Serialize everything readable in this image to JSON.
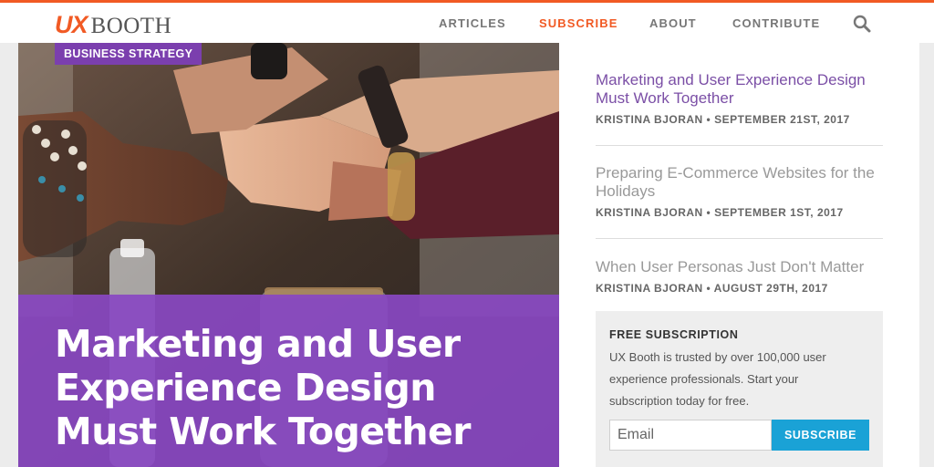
{
  "brand": {
    "logo_ux": "UX",
    "logo_booth": "BOOTH",
    "accent_color": "#f15a24",
    "purple_color": "#7b3fae",
    "button_color": "#1aa2d6"
  },
  "nav": {
    "items": [
      {
        "label": "ARTICLES"
      },
      {
        "label": "SUBSCRIBE",
        "active": true
      },
      {
        "label": "ABOUT"
      },
      {
        "label": "CONTRIBUTE"
      }
    ],
    "search_icon": "search-icon"
  },
  "hero": {
    "category": "BUSINESS STRATEGY",
    "title": "Marketing and User Experience Design Must Work Together"
  },
  "sidebar": {
    "articles": [
      {
        "title": "Marketing and User Experience Design Must Work Together",
        "meta": "KRISTINA BJORAN • SEPTEMBER 21ST, 2017"
      },
      {
        "title": "Preparing E-Commerce Websites for the Holidays",
        "meta": "KRISTINA BJORAN • SEPTEMBER 1ST, 2017"
      },
      {
        "title": "When User Personas Just Don't Matter",
        "meta": "KRISTINA BJORAN • AUGUST 29TH, 2017"
      }
    ]
  },
  "subscription": {
    "heading": "FREE SUBSCRIPTION",
    "text": "UX Booth is trusted by over 100,000 user experience professionals. Start your subscription today for free.",
    "email_placeholder": "Email",
    "button_label": "SUBSCRIBE"
  }
}
